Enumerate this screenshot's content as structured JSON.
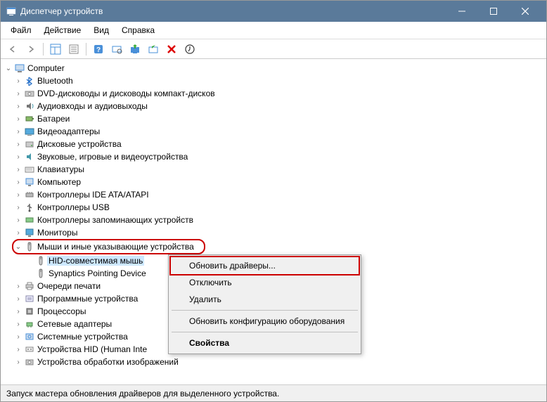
{
  "window": {
    "title": "Диспетчер устройств"
  },
  "menu": {
    "file": "Файл",
    "action": "Действие",
    "view": "Вид",
    "help": "Справка"
  },
  "tree": {
    "root": "Computer",
    "cat": {
      "bluetooth": "Bluetooth",
      "dvd": "DVD-дисководы и дисководы компакт-дисков",
      "audio": "Аудиовходы и аудиовыходы",
      "battery": "Батареи",
      "video": "Видеоадаптеры",
      "disk": "Дисковые устройства",
      "sound": "Звуковые, игровые и видеоустройства",
      "keyboard": "Клавиатуры",
      "computer": "Компьютер",
      "ide": "Контроллеры IDE ATA/ATAPI",
      "usb": "Контроллеры USB",
      "storage": "Контроллеры запоминающих устройств",
      "monitor": "Мониторы",
      "mouse": "Мыши и иные указывающие устройства",
      "printqueue": "Очереди печати",
      "software": "Программные устройства",
      "cpu": "Процессоры",
      "net": "Сетевые адаптеры",
      "system": "Системные устройства",
      "hid": "Устройства HID (Human Inte",
      "imaging": "Устройства обработки изображений"
    },
    "mouse_children": {
      "hid": "HID-совместимая мышь",
      "syn": "Synaptics Pointing Device"
    }
  },
  "context": {
    "update": "Обновить драйверы...",
    "disable": "Отключить",
    "delete": "Удалить",
    "refresh": "Обновить конфигурацию оборудования",
    "props": "Свойства"
  },
  "status": "Запуск мастера обновления драйверов для выделенного устройства."
}
